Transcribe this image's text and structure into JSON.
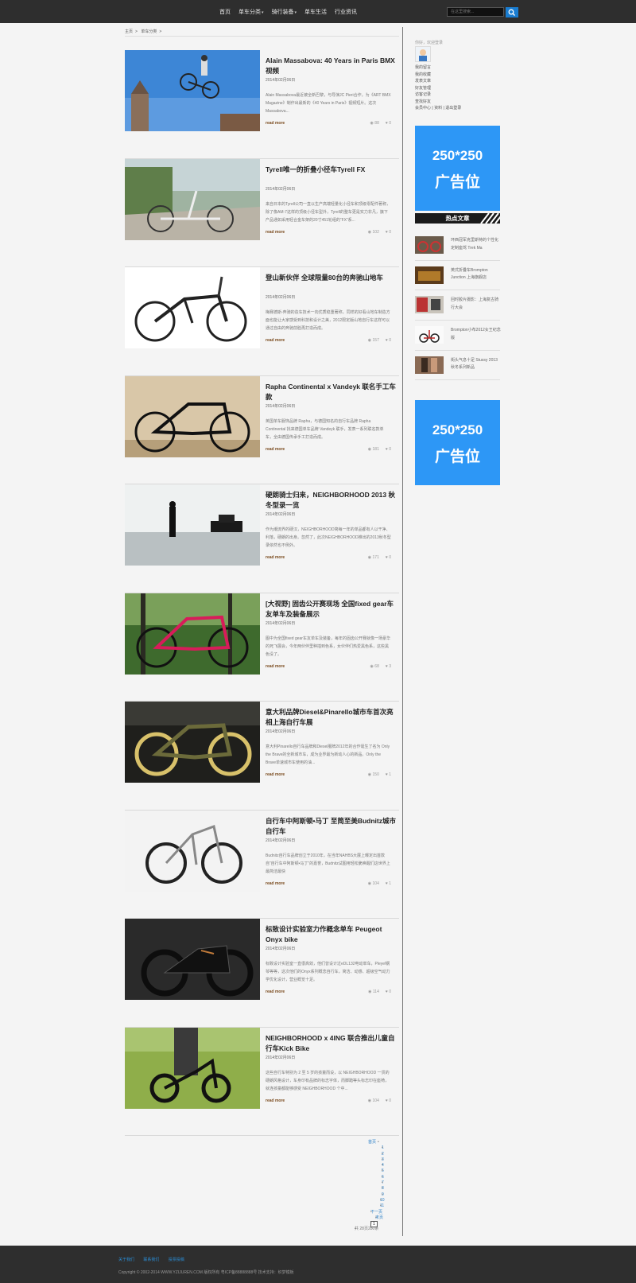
{
  "header": {
    "nav": [
      {
        "label": "首页",
        "has_dropdown": false
      },
      {
        "label": "单车分类",
        "has_dropdown": true
      },
      {
        "label": "骑行装备",
        "has_dropdown": true
      },
      {
        "label": "单车生活",
        "has_dropdown": false
      },
      {
        "label": "行业资讯",
        "has_dropdown": false
      }
    ],
    "search_placeholder": "在这里搜索..."
  },
  "breadcrumb": [
    "主页",
    "单车分类"
  ],
  "articles": [
    {
      "title": "Alain Massabova: 40 Years in Paris BMX 视频",
      "date": "2014年02月06日",
      "excerpt": "Alain Massabova最近被全新巴黎，与导演JC Pieri合作，为《ART BMX Magazine》制作出最新的《40 Years in Paris》视频短片。这次Massabova...",
      "read_more": "read more",
      "views": "88",
      "likes": "0"
    },
    {
      "title": "Tyrell唯一的折叠小径车Tyrell FX",
      "date": "2014年02月06日",
      "excerpt": "来自日本的Tyrell公司一直以生产高端轻量化小径车和顶级零配件著称，除了像AM-7这样的顶级小径车型外，Tyrell的整车更是实力非凡，旗下产品通如采用轻合金车架的20寸451轮组的“FX”系...",
      "read_more": "read more",
      "views": "102",
      "likes": "0"
    },
    {
      "title": "登山新伙伴 全球限量80台的奔驰山地车",
      "date": "2014年02月06日",
      "excerpt": "梅赛德斯-奔驰的造车技术一向优质稳重著称，同样的好看山地车制造方面也能让大家感受到科技和设计之美，2012限定版山地自行车这样可以通过自由的奔驰前脸再打造而成。",
      "read_more": "read more",
      "views": "157",
      "likes": "0"
    },
    {
      "title": "Rapha Continental x Vandeyk 联名手工车款",
      "date": "2014年02月06日",
      "excerpt": "英国单车服饰品牌 Rapha，与德国知名的自行车品牌 Rapha Continental 找来德国单车品牌 Vandeyk 联手，发表一系列联名款单车，全由德国传承手工打造而成。",
      "read_more": "read more",
      "views": "181",
      "likes": "0"
    },
    {
      "title": "硬朗骑士归来，NEIGHBORHOOD 2013 秋冬型录一览",
      "date": "2014年02月06日",
      "excerpt": "作为潮流界的硬汉，NEIGHBORHOOD简每一年的单品都有人以干净、利落，硬朗的出身。忽然了，此次NEIGHBORHOOD推出的2013秋冬型录依然也不例外。",
      "read_more": "read more",
      "views": "171",
      "likes": "0"
    },
    {
      "title": "[大视野] 固齿公开赛现场 全国fixed gear车友单车及装备展示",
      "date": "2014年02月06日",
      "excerpt": "图中为全国fixed gear车友单车及装备，每年的固齿公开赛就像一场豪华的死飞展会，今年两伙伴里种插到色系，女伙伴们热爱黑色系，这些黑色没了。",
      "read_more": "read more",
      "views": "68",
      "likes": "3"
    },
    {
      "title": "意大利品牌Diesel&Pinarello城市车首次亮相上海自行车展",
      "date": "2014年02月06日",
      "excerpt": "意大利Pinarello自行车品牌和Diesel服牌2012年的合作诞生了名为 Only the Brave的全新城市车，成为业界最为新动人心的新品。Only the Brave单速城市车使用的油...",
      "read_more": "read more",
      "views": "150",
      "likes": "1"
    },
    {
      "title": "自行车中阿斯顿•马丁 至简至美Budnitz城市自行车",
      "date": "2014年02月06日",
      "excerpt": "Budnitz自行车品牌创立于2010年，在当年NAHBS大展上曝定出首款自“自行车中阿斯顿•马丁”的嘉誉，Budnitz试图用轻松脆唤醒们这世界上最简洁最快",
      "read_more": "read more",
      "views": "104",
      "likes": "1"
    },
    {
      "title": "标致设计实验室力作概念单车 Peugeot Onyx bike",
      "date": "2014年02月06日",
      "excerpt": "标致设计实验室一直很高效，他们曾设计过eDL132电动单车，Pleyel钢琴等等，这次他们的Onyx系列概念自行车，简洁、动感、超级空气动力学优化设计，营业概览十足。",
      "read_more": "read more",
      "views": "114",
      "likes": "0"
    },
    {
      "title": "NEIGHBORHOOD x 4ING 联合推出儿童自行车Kick Bike",
      "date": "2014年02月06日",
      "excerpt": "这些自行车特别为 2 至 5 岁的孩童而设，以 NEIGHBORHOOD 一贯的硬朗风格设计，车身印有品牌的标志字体，而脚踏等头标志印在座椅，就连孩童都能够感受 NEIGHBORHOOD 个中...",
      "read_more": "read more",
      "views": "104",
      "likes": "0"
    }
  ],
  "pagination": [
    "首页",
    "1",
    "2",
    "3",
    "4",
    "5",
    "6",
    "7",
    "8",
    "9",
    "10",
    "11",
    "下一页",
    "末页",
    "1",
    "共 28页280条"
  ],
  "sidebar": {
    "welcome": "你好，欢迎登录",
    "user_links": [
      "我的留言",
      "我的收藏",
      "发表文章",
      "好友管理",
      "访客记录",
      "查找好友"
    ],
    "user_bottom": [
      "会员中心",
      "资料",
      "退出登录"
    ],
    "ad_line1": "250*250",
    "ad_line2": "广告位",
    "hot_title": "热点文章",
    "hot_articles": [
      "环西冠军克里斯特的个性化定制座驾 Trek Ma",
      "英式折叠车Brompton Junction 上海旗舰店",
      "回时胶片摄影：上海复古骑行大会",
      "Brompton小布2012女王纪念版",
      "街头气息十足 Stussy 2013 秋冬系列新品"
    ]
  },
  "footer": {
    "links": [
      "关于我们",
      "联系我们",
      "投票投稿"
    ],
    "copyright": "Copyright © 2002-2014 WWW.YZIJUREN.COM 版权所有    粤ICP备88888888号    技术支持：织梦模板"
  }
}
